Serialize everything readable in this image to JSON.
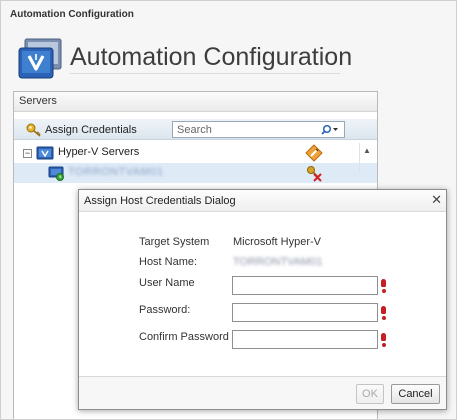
{
  "window": {
    "title": "Automation Configuration"
  },
  "header": {
    "title": "Automation Configuration",
    "icon": "automation-app-icon"
  },
  "servers_panel": {
    "title": "Servers",
    "toolbar": {
      "assign_label": "Assign Credentials",
      "assign_icon": "key-icon",
      "search_placeholder": "Search",
      "search_icon": "magnifier-icon"
    },
    "tree": [
      {
        "label": "Hyper-V Servers",
        "expanded": true,
        "icon": "hyperv-servers-icon",
        "action_icon": "edit-credentials-icon"
      },
      {
        "label": "TORRONTVAM01",
        "obscured": true,
        "selected": true,
        "icon": "server-node-icon",
        "action_icon": "no-credentials-icon"
      }
    ]
  },
  "dialog": {
    "title": "Assign Host Credentials Dialog",
    "rows": [
      {
        "label": "Target System",
        "value": "Microsoft Hyper-V"
      },
      {
        "label": "Host Name:",
        "value": "TORRONTVAM01",
        "obscured": true
      }
    ],
    "fields": [
      {
        "label": "User Name",
        "value": "",
        "required": true
      },
      {
        "label": "Password:",
        "value": "",
        "required": true
      },
      {
        "label": "Confirm Password",
        "value": "",
        "required": true
      }
    ],
    "buttons": {
      "ok": "OK",
      "cancel": "Cancel",
      "ok_enabled": false
    }
  },
  "colors": {
    "accent": "#1f5fa8",
    "required": "#c51e24",
    "selection": "#dfeaf7"
  }
}
